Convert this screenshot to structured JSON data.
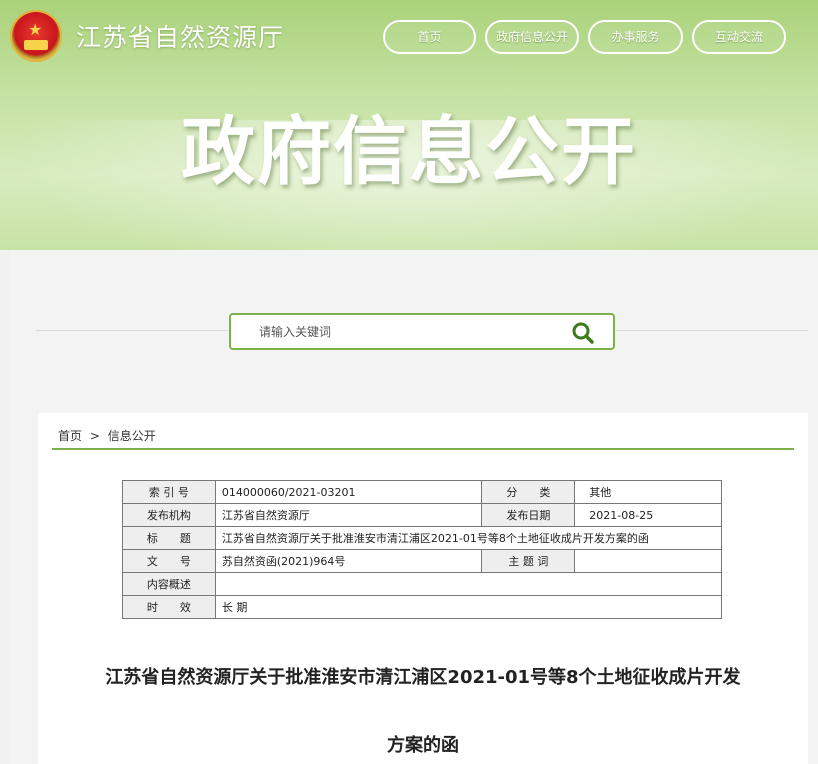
{
  "header": {
    "site_title": "江苏省自然资源厅",
    "hero_title": "政府信息公开",
    "nav": [
      {
        "label": "首页"
      },
      {
        "label": "政府信息公开"
      },
      {
        "label": "办事服务"
      },
      {
        "label": "互动交流"
      }
    ]
  },
  "search": {
    "placeholder": "请输入关键词",
    "icon": "search-icon"
  },
  "breadcrumb": {
    "home": "首页",
    "separator": ">",
    "current": "信息公开"
  },
  "meta": {
    "index_no_label": "索 引 号",
    "index_no": "014000060/2021-03201",
    "category_label": "分　　类",
    "category": "其他",
    "publisher_label": "发布机构",
    "publisher": "江苏省自然资源厅",
    "date_label": "发布日期",
    "date": "2021-08-25",
    "title_label": "标　　题",
    "title": "江苏省自然资源厅关于批准淮安市清江浦区2021-01号等8个土地征收成片开发方案的函",
    "doc_no_label": "文　　号",
    "doc_no": "苏自然资函(2021)964号",
    "subject_label": "主 题 词",
    "subject": "",
    "summary_label": "内容概述",
    "summary": "",
    "validity_label": "时　　效",
    "validity": "长 期"
  },
  "document": {
    "title_line1": "江苏省自然资源厅关于批准淮安市清江浦区2021-01号等8个土地征收成片开发",
    "title_line2": "方案的函"
  },
  "colors": {
    "accent": "#7db24a",
    "banner": "#c4e1a0"
  }
}
